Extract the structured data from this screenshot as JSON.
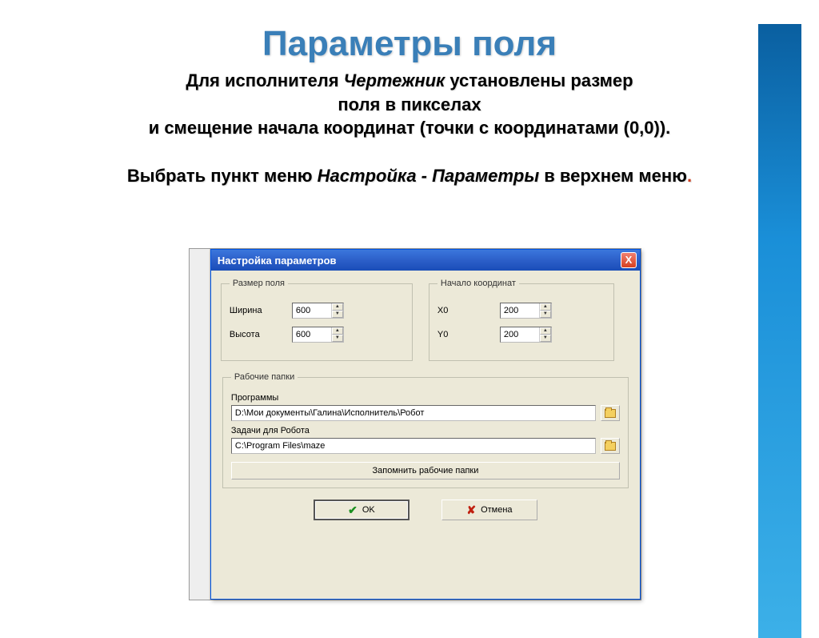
{
  "slide": {
    "title": "Параметры поля",
    "line1_a": "Для исполнителя ",
    "line1_em": "Чертежник",
    "line1_b": "  установлены размер",
    "line2": "поля в пикселах",
    "line3": "и смещение начала координат (точки с координатами (0,0)).",
    "line4_a": "Выбрать пункт меню ",
    "line4_em": "Настройка - Параметры",
    "line4_b": " в верхнем меню",
    "dot": "."
  },
  "dialog": {
    "title": "Настройка параметров",
    "close": "X",
    "size_legend": "Размер поля",
    "width_label": "Ширина",
    "width_value": "600",
    "height_label": "Высота",
    "height_value": "600",
    "origin_legend": "Начало координат",
    "x0_label": "X0",
    "x0_value": "200",
    "y0_label": "Y0",
    "y0_value": "200",
    "folders_legend": "Рабочие папки",
    "programs_label": "Программы",
    "programs_path": "D:\\Мои документы\\Галина\\Исполнитель\\Робот",
    "tasks_label": "Задачи для Робота",
    "tasks_path": "C:\\Program Files\\maze",
    "remember": "Запомнить рабочие папки",
    "ok": "OK",
    "cancel": "Отмена"
  }
}
